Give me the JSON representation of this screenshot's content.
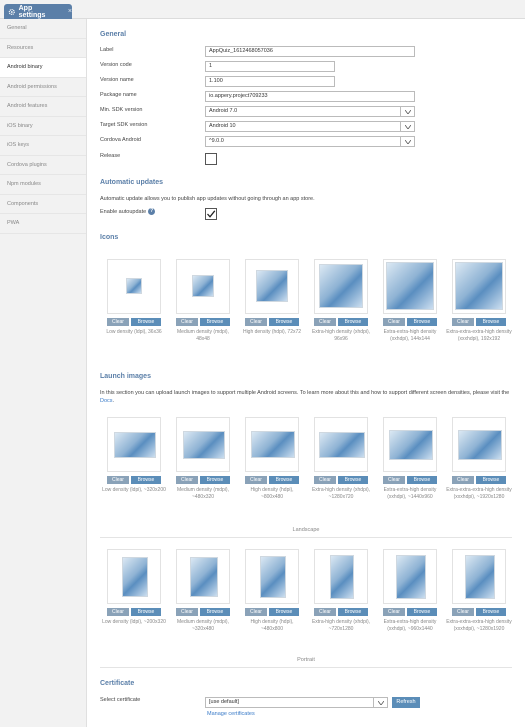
{
  "tab": {
    "title": "App settings",
    "close": "×"
  },
  "sidebar": {
    "items": [
      {
        "label": "General",
        "active": false
      },
      {
        "label": "Resources",
        "active": false
      },
      {
        "label": "Android binary",
        "active": true
      },
      {
        "label": "Android permissions",
        "active": false
      },
      {
        "label": "Android features",
        "active": false
      },
      {
        "label": "iOS binary",
        "active": false
      },
      {
        "label": "iOS keys",
        "active": false
      },
      {
        "label": "Cordova plugins",
        "active": false
      },
      {
        "label": "Npm modules",
        "active": false
      },
      {
        "label": "Components",
        "active": false
      },
      {
        "label": "PWA",
        "active": false
      }
    ]
  },
  "general": {
    "title": "General",
    "label_label": "Label",
    "label_value": "AppQuiz_1612468057036",
    "version_code_label": "Version code",
    "version_code_value": "1",
    "version_name_label": "Version name",
    "version_name_value": "1.100",
    "package_name_label": "Package name",
    "package_name_value": "io.appery.project709233",
    "min_sdk_label": "Min. SDK version",
    "min_sdk_value": "Android 7.0",
    "target_sdk_label": "Target SDK version",
    "target_sdk_value": "Android 10",
    "cordova_label": "Cordova Android",
    "cordova_value": "^9.0.0",
    "release_label": "Release",
    "release_checked": false
  },
  "updates": {
    "title": "Automatic updates",
    "description": "Automatic update allows you to publish app updates without going through an app store.",
    "enable_label": "Enable autoupdate",
    "help": "?",
    "enabled": true
  },
  "icons": {
    "title": "Icons",
    "items": [
      {
        "caption": "Low density (ldpi), 36x36"
      },
      {
        "caption": "Medium density (mdpi), 48x48"
      },
      {
        "caption": "High density (hdpi), 72x72"
      },
      {
        "caption": "Extra-high density (xhdpi), 96x96"
      },
      {
        "caption": "Extra-extra-high density (xxhdpi), 144x144"
      },
      {
        "caption": "Extra-extra-extra-high density (xxxhdpi), 192x192"
      }
    ]
  },
  "buttons": {
    "clear": "Clear",
    "browse": "Browse",
    "refresh": "Refresh"
  },
  "launch": {
    "title": "Launch images",
    "description_pre": "In this section you can upload launch images to support multiple Android screens. To learn more about this and how to support different screen densities, please visit the ",
    "docs_link": "Docs",
    "description_post": ".",
    "landscape_label": "Landscape",
    "portrait_label": "Portrait",
    "landscape": [
      {
        "caption": "Low density (ldpi), ~320x200"
      },
      {
        "caption": "Medium density (mdpi), ~480x320"
      },
      {
        "caption": "High density (hdpi), ~800x480"
      },
      {
        "caption": "Extra-high density (xhdpi), ~1280x720"
      },
      {
        "caption": "Extra-extra-high density (xxhdpi), ~1440x960"
      },
      {
        "caption": "Extra-extra-extra-high density (xxxhdpi), ~1920x1280"
      }
    ],
    "portrait": [
      {
        "caption": "Low density (ldpi), ~200x320"
      },
      {
        "caption": "Medium density (mdpi), ~320x480"
      },
      {
        "caption": "High density (hdpi), ~480x800"
      },
      {
        "caption": "Extra-high density (xhdpi), ~720x1280"
      },
      {
        "caption": "Extra-extra-high density (xxhdpi), ~960x1440"
      },
      {
        "caption": "Extra-extra-extra-high density (xxxhdpi), ~1280x1920"
      }
    ]
  },
  "certificate": {
    "title": "Certificate",
    "select_label": "Select certificate",
    "select_value": "[use default]",
    "manage_link": "Manage certificates"
  },
  "colors": {
    "accent": "#5b7fa8",
    "button": "#5b8db8",
    "link": "#3a7bc8"
  }
}
